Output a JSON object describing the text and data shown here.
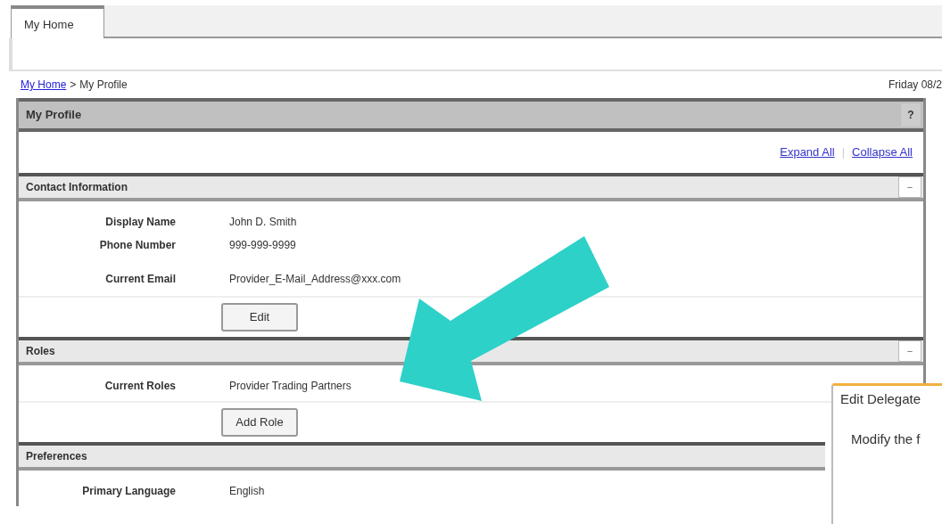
{
  "tabs": [
    {
      "label": "My Home",
      "selected": true
    }
  ],
  "breadcrumb": {
    "link": "My Home",
    "separator": ">",
    "current": "My Profile"
  },
  "date": "Friday 08/2",
  "panel": {
    "title": "My Profile",
    "help": "?",
    "links": [
      "Expand All",
      "Collapse All"
    ],
    "link_separator": "|"
  },
  "sections": [
    {
      "title": "Contact Information",
      "toggle": "−",
      "fields": [
        {
          "label": "Display Name",
          "value": "John D. Smith"
        },
        {
          "label": "Phone Number",
          "value": "999-999-9999"
        },
        {
          "label": "Current Email",
          "value": "Provider_E-Mail_Address@xxx.com"
        }
      ],
      "button": "Edit"
    },
    {
      "title": "Roles",
      "toggle": "−",
      "fields": [
        {
          "label": "Current Roles",
          "value": "Provider Trading Partners"
        }
      ],
      "button": "Add Role"
    },
    {
      "title": "Preferences",
      "fields": [
        {
          "label": "Primary Language",
          "value": "English"
        }
      ]
    }
  ],
  "dialog": {
    "title": "Edit Delegate",
    "text": "Modify the f"
  }
}
